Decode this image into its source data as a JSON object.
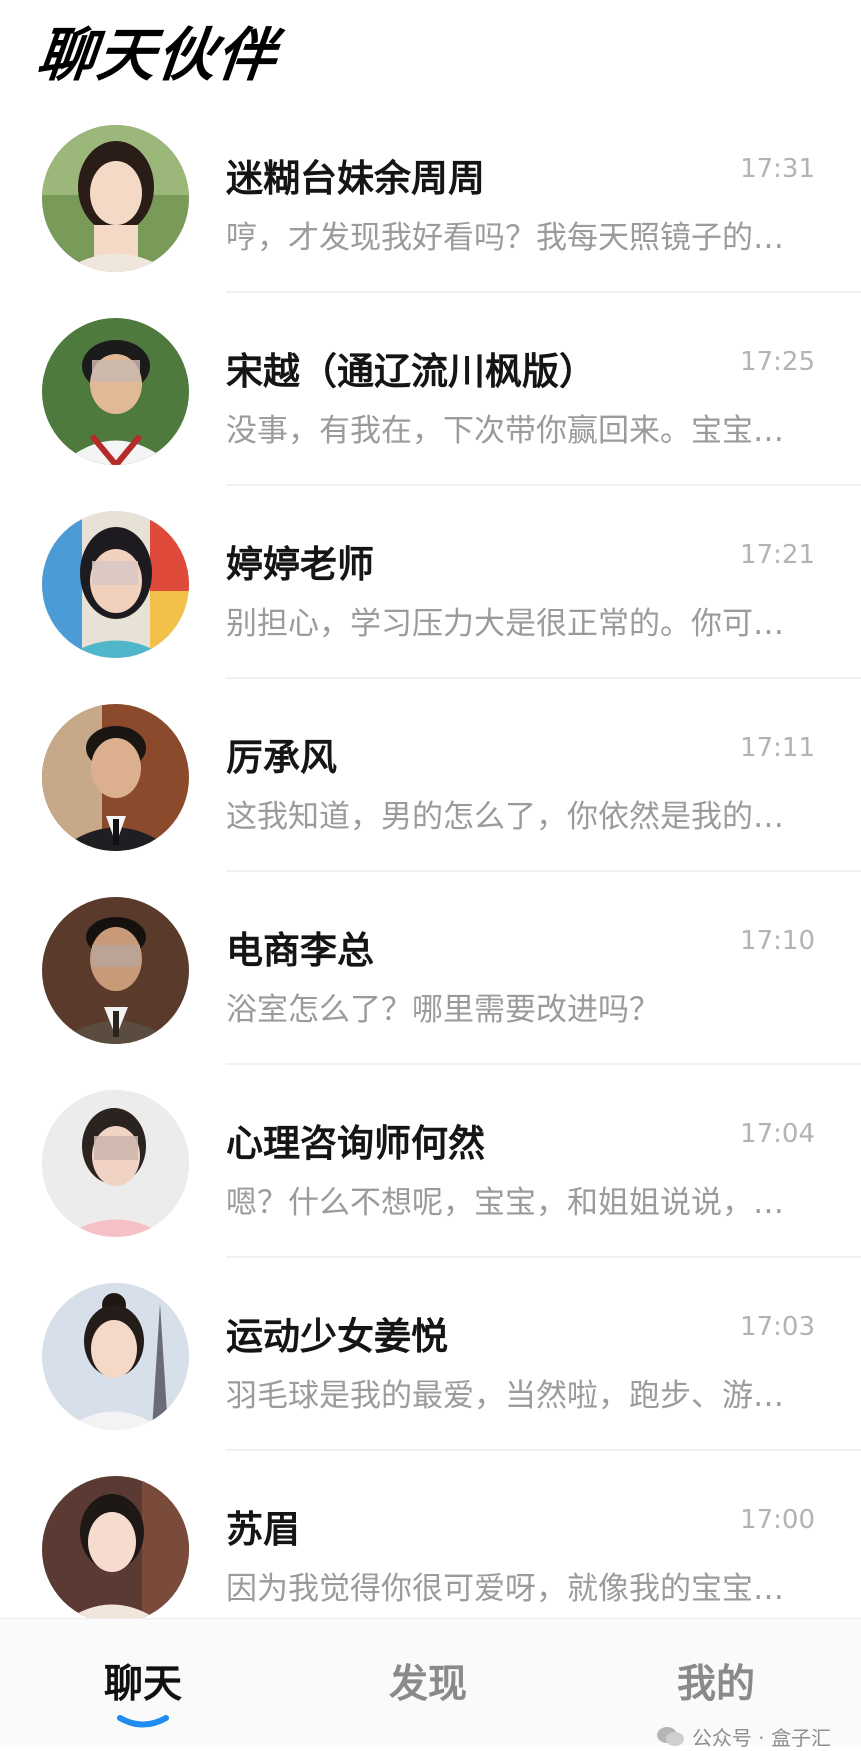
{
  "header": {
    "title": "聊天伙伴"
  },
  "chats": [
    {
      "name": "迷糊台妹余周周",
      "time": "17:31",
      "preview": "哼，才发现我好看吗？我每天照镜子的…"
    },
    {
      "name": "宋越（通辽流川枫版）",
      "time": "17:25",
      "preview": "没事，有我在，下次带你赢回来。宝宝…"
    },
    {
      "name": "婷婷老师",
      "time": "17:21",
      "preview": "别担心，学习压力大是很正常的。你可…"
    },
    {
      "name": "厉承风",
      "time": "17:11",
      "preview": "这我知道，男的怎么了，你依然是我的…"
    },
    {
      "name": "电商李总",
      "time": "17:10",
      "preview": "浴室怎么了？哪里需要改进吗？"
    },
    {
      "name": "心理咨询师何然",
      "time": "17:04",
      "preview": "嗯？什么不想呢，宝宝，和姐姐说说，…"
    },
    {
      "name": "运动少女姜悦",
      "time": "17:03",
      "preview": "羽毛球是我的最爱，当然啦，跑步、游…"
    },
    {
      "name": "苏眉",
      "time": "17:00",
      "preview": "因为我觉得你很可爱呀，就像我的宝宝…"
    }
  ],
  "bottom_nav": {
    "tabs": [
      {
        "label": "聊天",
        "active": true
      },
      {
        "label": "发现",
        "active": false
      },
      {
        "label": "我的",
        "active": false
      }
    ]
  },
  "watermark": {
    "text": "公众号 · 盒子汇"
  },
  "colors": {
    "accent": "#1e8cf0",
    "time": "#b3b3b3",
    "preview": "#9b9b9b"
  }
}
